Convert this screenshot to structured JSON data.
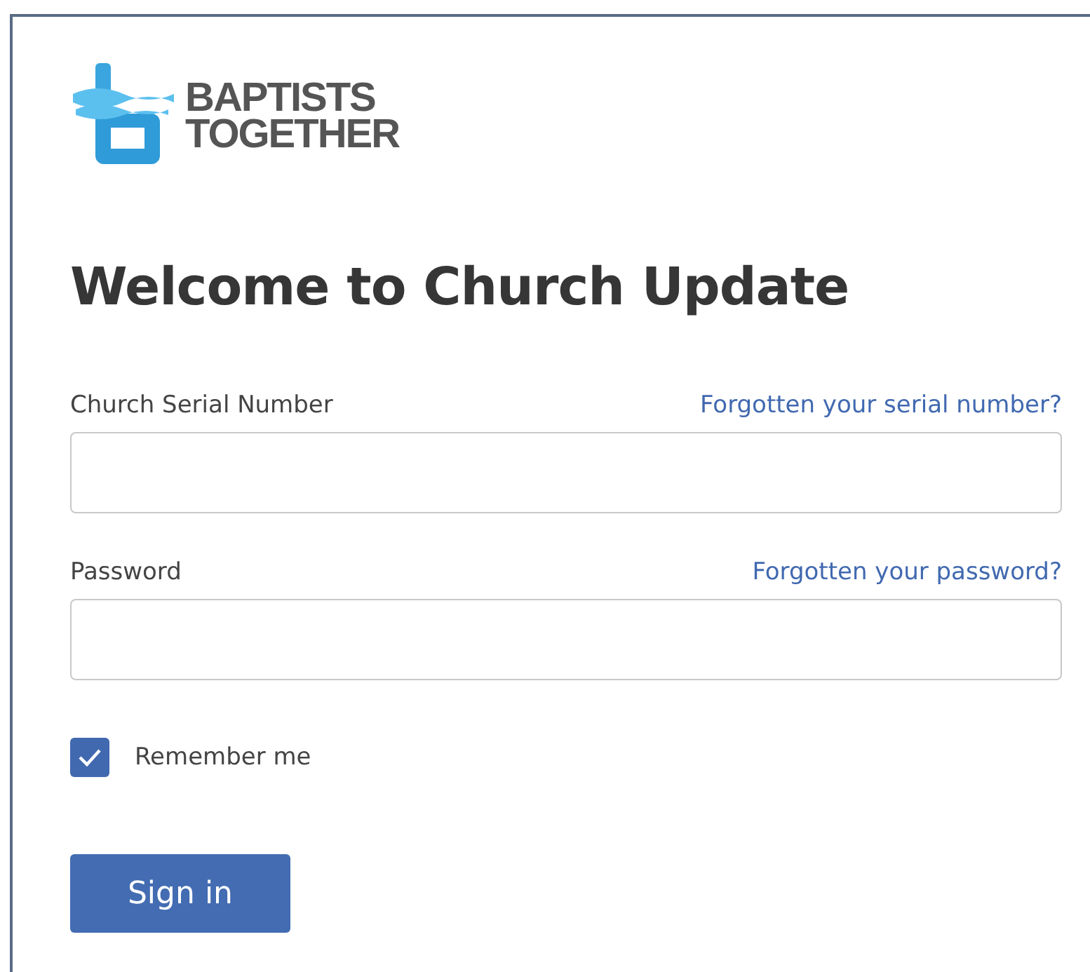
{
  "logo": {
    "lines": [
      "BAPTISTS",
      "TOGETHER"
    ]
  },
  "title": "Welcome to Church Update",
  "fields": [
    {
      "label": "Church Serial Number",
      "link": "Forgotten your serial number?"
    },
    {
      "label": "Password",
      "link": "Forgotten your password?"
    }
  ],
  "remember": {
    "label": "Remember me",
    "checked": true
  },
  "button": "Sign in"
}
